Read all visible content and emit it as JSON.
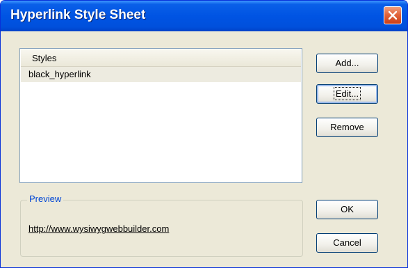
{
  "window": {
    "title": "Hyperlink Style Sheet"
  },
  "styles_list": {
    "header": "Styles",
    "items": [
      "black_hyperlink"
    ]
  },
  "preview": {
    "label": "Preview",
    "link_text": "http://www.wysiwygwebbuilder.com"
  },
  "buttons": {
    "add": "Add...",
    "edit": "Edit...",
    "remove": "Remove",
    "ok": "OK",
    "cancel": "Cancel"
  },
  "colors": {
    "titlebar": "#0054e3",
    "close": "#e2653d",
    "dialog_bg": "#ece9d8",
    "group_label": "#0046d5"
  },
  "icons": {
    "close": "close-icon"
  }
}
